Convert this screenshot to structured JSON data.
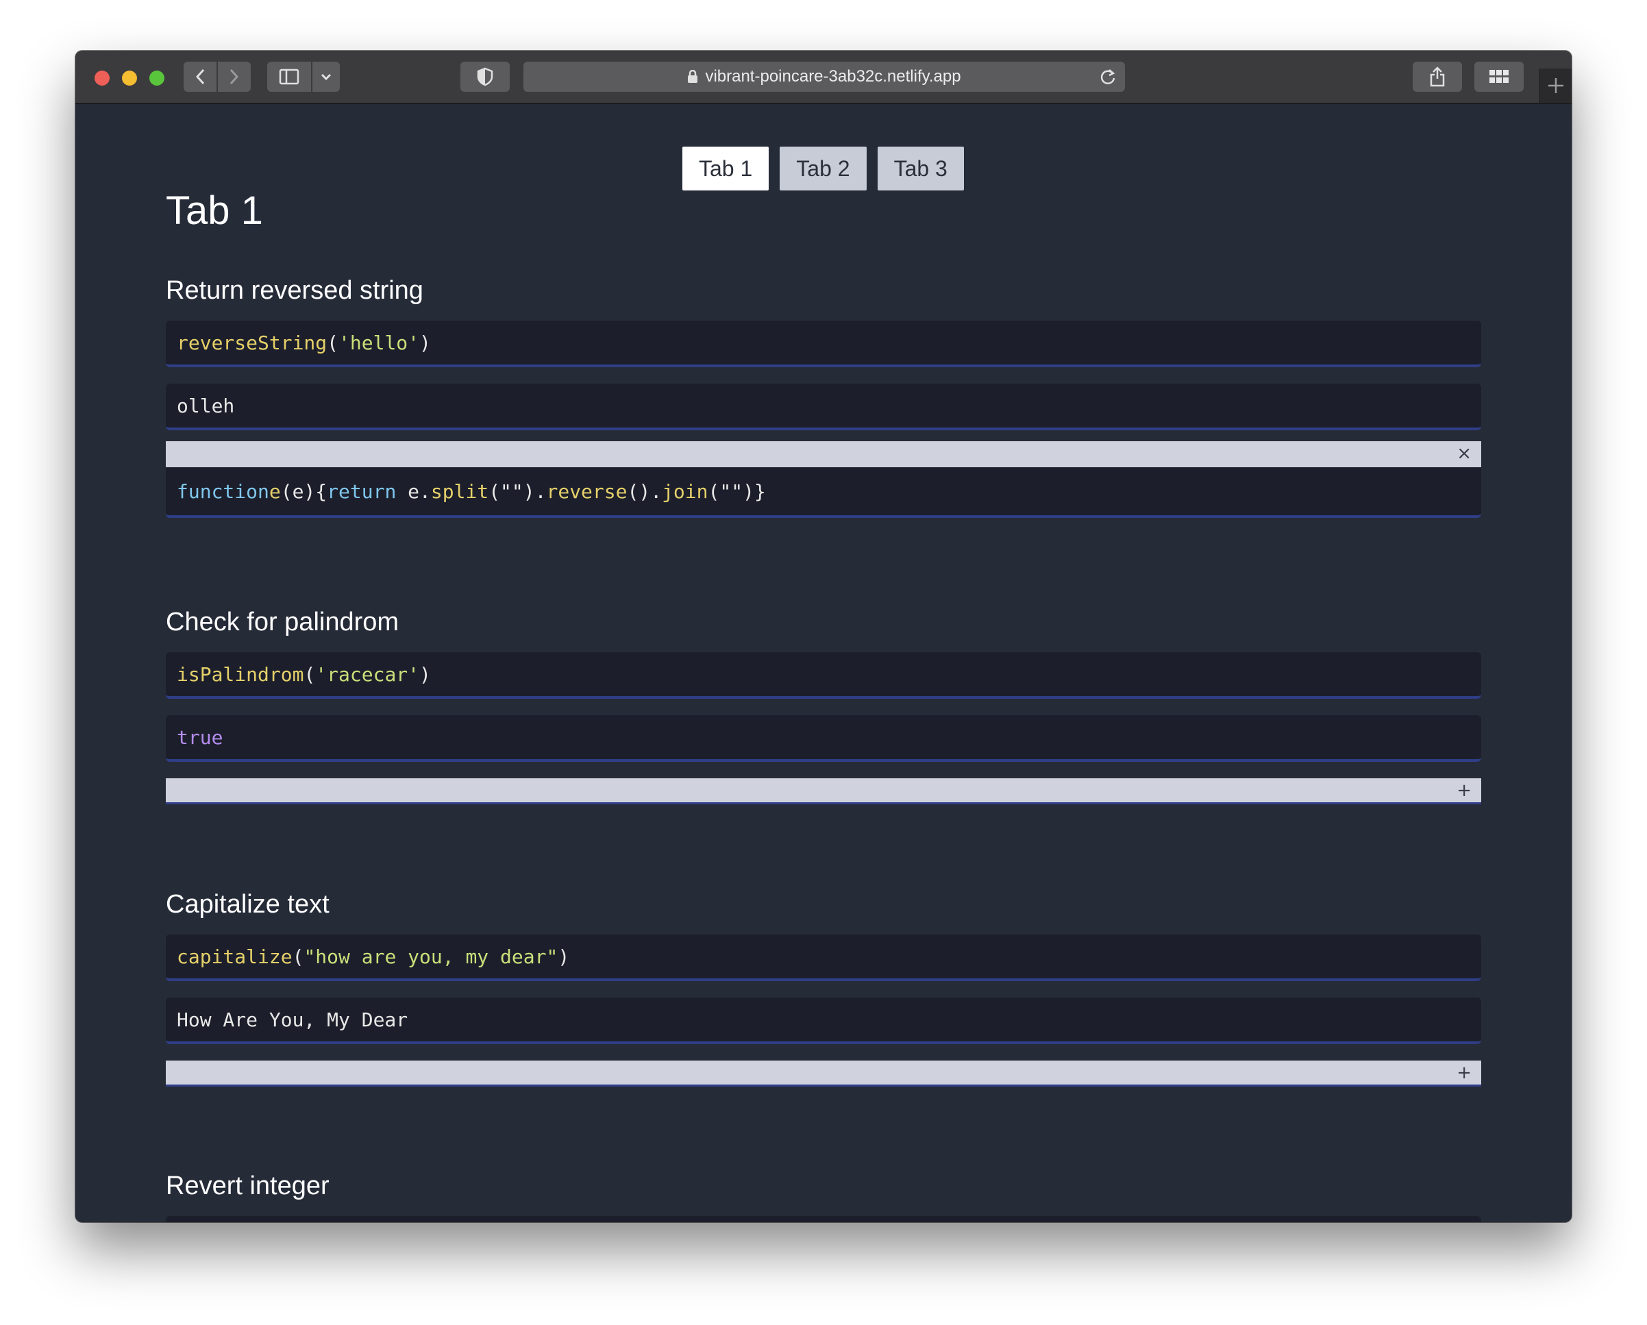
{
  "browser": {
    "url": "vibrant-poincare-3ab32c.netlify.app"
  },
  "tabs": [
    {
      "label": "Tab 1",
      "active": true
    },
    {
      "label": "Tab 2",
      "active": false
    },
    {
      "label": "Tab 3",
      "active": false
    }
  ],
  "page_title": "Tab 1",
  "sections": [
    {
      "title": "Return reversed string",
      "call_fn": "reverseString",
      "call_arg": "'hello'",
      "result": "olleh",
      "expanded": true,
      "toggle": "×",
      "source": {
        "kw_function": "function",
        "name": "e",
        "params": "(e){",
        "kw_return": "return",
        "obj": " e.",
        "m1": "split",
        "a1": "(\"\").",
        "m2": "reverse",
        "a2": "().",
        "m3": "join",
        "a3": "(\"\")}"
      }
    },
    {
      "title": "Check for palindrom",
      "call_fn": "isPalindrom",
      "call_arg": "'racecar'",
      "result": "true",
      "expanded": false,
      "toggle": "+"
    },
    {
      "title": "Capitalize text",
      "call_fn": "capitalize",
      "call_arg": "\"how are you, my dear\"",
      "result": "How Are You, My Dear",
      "expanded": false,
      "toggle": "+"
    },
    {
      "title": "Revert integer"
    }
  ],
  "icons": [
    "back-icon",
    "forward-icon",
    "sidebar-icon",
    "chevron-down-icon",
    "shield-icon",
    "lock-icon",
    "reload-icon",
    "share-icon",
    "grid-icon",
    "plus-icon"
  ]
}
